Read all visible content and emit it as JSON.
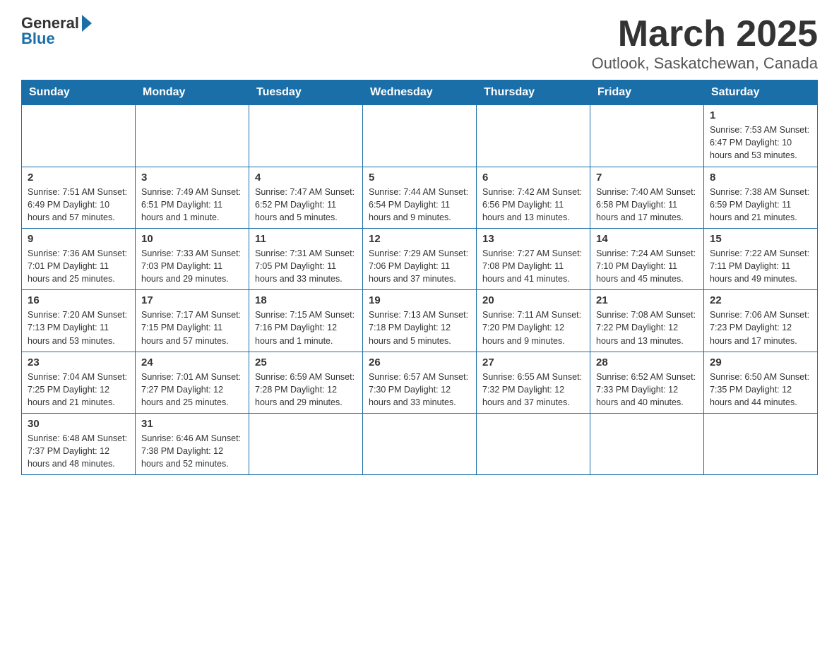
{
  "header": {
    "logo": {
      "general": "General",
      "blue": "Blue"
    },
    "title": "March 2025",
    "location": "Outlook, Saskatchewan, Canada"
  },
  "weekdays": [
    "Sunday",
    "Monday",
    "Tuesday",
    "Wednesday",
    "Thursday",
    "Friday",
    "Saturday"
  ],
  "weeks": [
    [
      {
        "day": "",
        "info": ""
      },
      {
        "day": "",
        "info": ""
      },
      {
        "day": "",
        "info": ""
      },
      {
        "day": "",
        "info": ""
      },
      {
        "day": "",
        "info": ""
      },
      {
        "day": "",
        "info": ""
      },
      {
        "day": "1",
        "info": "Sunrise: 7:53 AM\nSunset: 6:47 PM\nDaylight: 10 hours\nand 53 minutes."
      }
    ],
    [
      {
        "day": "2",
        "info": "Sunrise: 7:51 AM\nSunset: 6:49 PM\nDaylight: 10 hours\nand 57 minutes."
      },
      {
        "day": "3",
        "info": "Sunrise: 7:49 AM\nSunset: 6:51 PM\nDaylight: 11 hours\nand 1 minute."
      },
      {
        "day": "4",
        "info": "Sunrise: 7:47 AM\nSunset: 6:52 PM\nDaylight: 11 hours\nand 5 minutes."
      },
      {
        "day": "5",
        "info": "Sunrise: 7:44 AM\nSunset: 6:54 PM\nDaylight: 11 hours\nand 9 minutes."
      },
      {
        "day": "6",
        "info": "Sunrise: 7:42 AM\nSunset: 6:56 PM\nDaylight: 11 hours\nand 13 minutes."
      },
      {
        "day": "7",
        "info": "Sunrise: 7:40 AM\nSunset: 6:58 PM\nDaylight: 11 hours\nand 17 minutes."
      },
      {
        "day": "8",
        "info": "Sunrise: 7:38 AM\nSunset: 6:59 PM\nDaylight: 11 hours\nand 21 minutes."
      }
    ],
    [
      {
        "day": "9",
        "info": "Sunrise: 7:36 AM\nSunset: 7:01 PM\nDaylight: 11 hours\nand 25 minutes."
      },
      {
        "day": "10",
        "info": "Sunrise: 7:33 AM\nSunset: 7:03 PM\nDaylight: 11 hours\nand 29 minutes."
      },
      {
        "day": "11",
        "info": "Sunrise: 7:31 AM\nSunset: 7:05 PM\nDaylight: 11 hours\nand 33 minutes."
      },
      {
        "day": "12",
        "info": "Sunrise: 7:29 AM\nSunset: 7:06 PM\nDaylight: 11 hours\nand 37 minutes."
      },
      {
        "day": "13",
        "info": "Sunrise: 7:27 AM\nSunset: 7:08 PM\nDaylight: 11 hours\nand 41 minutes."
      },
      {
        "day": "14",
        "info": "Sunrise: 7:24 AM\nSunset: 7:10 PM\nDaylight: 11 hours\nand 45 minutes."
      },
      {
        "day": "15",
        "info": "Sunrise: 7:22 AM\nSunset: 7:11 PM\nDaylight: 11 hours\nand 49 minutes."
      }
    ],
    [
      {
        "day": "16",
        "info": "Sunrise: 7:20 AM\nSunset: 7:13 PM\nDaylight: 11 hours\nand 53 minutes."
      },
      {
        "day": "17",
        "info": "Sunrise: 7:17 AM\nSunset: 7:15 PM\nDaylight: 11 hours\nand 57 minutes."
      },
      {
        "day": "18",
        "info": "Sunrise: 7:15 AM\nSunset: 7:16 PM\nDaylight: 12 hours\nand 1 minute."
      },
      {
        "day": "19",
        "info": "Sunrise: 7:13 AM\nSunset: 7:18 PM\nDaylight: 12 hours\nand 5 minutes."
      },
      {
        "day": "20",
        "info": "Sunrise: 7:11 AM\nSunset: 7:20 PM\nDaylight: 12 hours\nand 9 minutes."
      },
      {
        "day": "21",
        "info": "Sunrise: 7:08 AM\nSunset: 7:22 PM\nDaylight: 12 hours\nand 13 minutes."
      },
      {
        "day": "22",
        "info": "Sunrise: 7:06 AM\nSunset: 7:23 PM\nDaylight: 12 hours\nand 17 minutes."
      }
    ],
    [
      {
        "day": "23",
        "info": "Sunrise: 7:04 AM\nSunset: 7:25 PM\nDaylight: 12 hours\nand 21 minutes."
      },
      {
        "day": "24",
        "info": "Sunrise: 7:01 AM\nSunset: 7:27 PM\nDaylight: 12 hours\nand 25 minutes."
      },
      {
        "day": "25",
        "info": "Sunrise: 6:59 AM\nSunset: 7:28 PM\nDaylight: 12 hours\nand 29 minutes."
      },
      {
        "day": "26",
        "info": "Sunrise: 6:57 AM\nSunset: 7:30 PM\nDaylight: 12 hours\nand 33 minutes."
      },
      {
        "day": "27",
        "info": "Sunrise: 6:55 AM\nSunset: 7:32 PM\nDaylight: 12 hours\nand 37 minutes."
      },
      {
        "day": "28",
        "info": "Sunrise: 6:52 AM\nSunset: 7:33 PM\nDaylight: 12 hours\nand 40 minutes."
      },
      {
        "day": "29",
        "info": "Sunrise: 6:50 AM\nSunset: 7:35 PM\nDaylight: 12 hours\nand 44 minutes."
      }
    ],
    [
      {
        "day": "30",
        "info": "Sunrise: 6:48 AM\nSunset: 7:37 PM\nDaylight: 12 hours\nand 48 minutes."
      },
      {
        "day": "31",
        "info": "Sunrise: 6:46 AM\nSunset: 7:38 PM\nDaylight: 12 hours\nand 52 minutes."
      },
      {
        "day": "",
        "info": ""
      },
      {
        "day": "",
        "info": ""
      },
      {
        "day": "",
        "info": ""
      },
      {
        "day": "",
        "info": ""
      },
      {
        "day": "",
        "info": ""
      }
    ]
  ]
}
